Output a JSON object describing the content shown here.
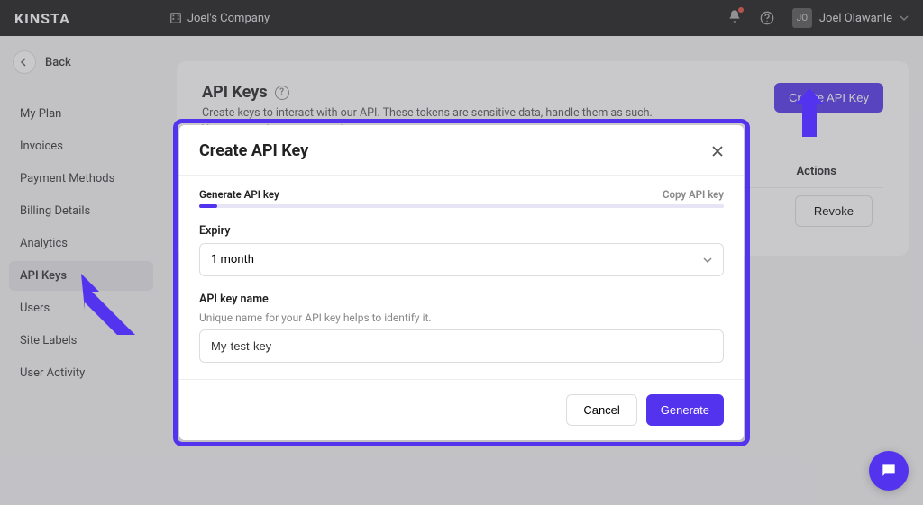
{
  "topbar": {
    "logo": "KINSTA",
    "company": "Joel's Company",
    "username": "Joel Olawanle"
  },
  "sidebar": {
    "back_label": "Back",
    "items": [
      {
        "label": "My Plan"
      },
      {
        "label": "Invoices"
      },
      {
        "label": "Payment Methods"
      },
      {
        "label": "Billing Details"
      },
      {
        "label": "Analytics"
      },
      {
        "label": "API Keys"
      },
      {
        "label": "Users"
      },
      {
        "label": "Site Labels"
      },
      {
        "label": "User Activity"
      }
    ],
    "active_index": 5
  },
  "page": {
    "title": "API Keys",
    "desc_line1": "Create keys to interact with our API. These tokens are sensitive data, handle them as such.",
    "desc_line2": "You can revoke access anytime you want.",
    "create_btn": "Create API Key",
    "col_actions": "Actions",
    "revoke_btn": "Revoke"
  },
  "modal": {
    "title": "Create API Key",
    "step1": "Generate API key",
    "step2": "Copy API key",
    "expiry_label": "Expiry",
    "expiry_value": "1 month",
    "name_label": "API key name",
    "name_help": "Unique name for your API key helps to identify it.",
    "name_value": "My-test-key",
    "cancel_btn": "Cancel",
    "generate_btn": "Generate"
  },
  "colors": {
    "accent": "#5333ed"
  }
}
